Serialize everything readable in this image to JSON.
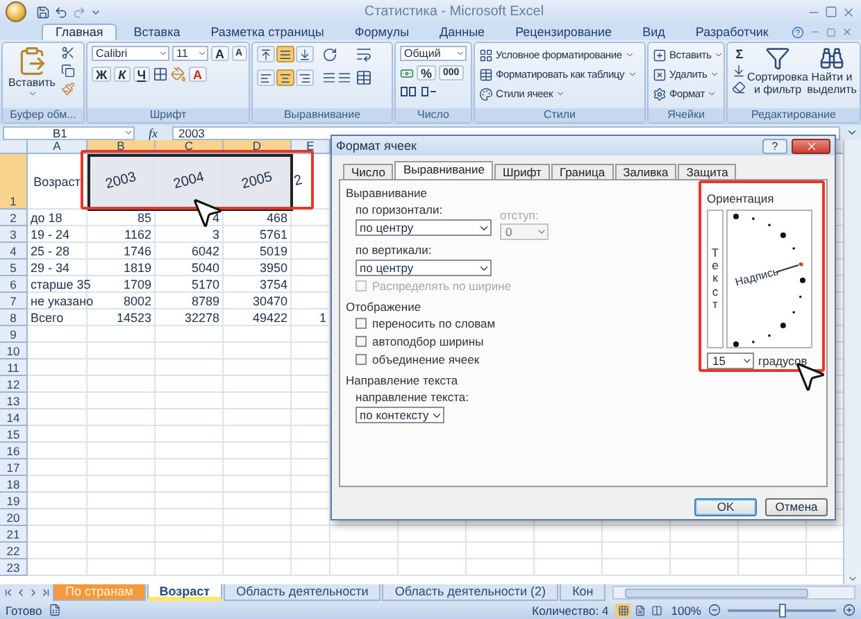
{
  "window": {
    "title": "Статистика - Microsoft Excel"
  },
  "ribbon_tabs": [
    {
      "label": "Главная",
      "selected": true
    },
    {
      "label": "Вставка",
      "selected": false
    },
    {
      "label": "Разметка страницы",
      "selected": false
    },
    {
      "label": "Формулы",
      "selected": false
    },
    {
      "label": "Данные",
      "selected": false
    },
    {
      "label": "Рецензирование",
      "selected": false
    },
    {
      "label": "Вид",
      "selected": false
    },
    {
      "label": "Разработчик",
      "selected": false
    }
  ],
  "ribbon": {
    "clipboard": {
      "label": "Буфер обм...",
      "paste": "Вставить"
    },
    "font": {
      "label": "Шрифт",
      "font_name": "Calibri",
      "font_size": "11",
      "grow": "A",
      "shrink": "A",
      "styles": [
        "Ж",
        "К",
        "Ч"
      ],
      "font_color": "A"
    },
    "alignment": {
      "label": "Выравнивание",
      "vertical": [
        {
          "selected": false
        },
        {
          "selected": true
        },
        {
          "selected": false
        }
      ],
      "horizontal": [
        {
          "selected": false
        },
        {
          "selected": true
        },
        {
          "selected": false
        }
      ]
    },
    "number": {
      "label": "Число",
      "format": "Общий",
      "percent": "%",
      "thousands": "000"
    },
    "styles": {
      "label": "Стили",
      "commands": [
        "Условное форматирование",
        "Форматировать как таблицу",
        "Стили ячеек"
      ]
    },
    "cells": {
      "label": "Ячейки",
      "commands": [
        "Вставить",
        "Удалить",
        "Формат"
      ]
    },
    "editing": {
      "label": "Редактирование",
      "sum": "Σ",
      "sort": "Сортировка и фильтр",
      "find": "Найти и выделить"
    }
  },
  "formula_bar": {
    "name_box": "B1",
    "function_label": "fx",
    "value": "2003"
  },
  "sheet": {
    "columns": [
      {
        "label": "A",
        "selected": false
      },
      {
        "label": "B",
        "selected": true
      },
      {
        "label": "C",
        "selected": true
      },
      {
        "label": "D",
        "selected": true
      },
      {
        "label": "E",
        "selected": false
      }
    ],
    "rows": [
      {
        "number": "1",
        "selected": true,
        "cells": [
          "Возраст",
          "2003",
          "2004",
          "2005",
          "2"
        ]
      },
      {
        "number": "2",
        "selected": false,
        "cells": [
          "до 18",
          "85",
          "4",
          "468",
          ""
        ]
      },
      {
        "number": "3",
        "selected": false,
        "cells": [
          "19 - 24",
          "1162",
          "3",
          "5761",
          ""
        ]
      },
      {
        "number": "4",
        "selected": false,
        "cells": [
          "25 - 28",
          "1746",
          "6042",
          "5019",
          ""
        ]
      },
      {
        "number": "5",
        "selected": false,
        "cells": [
          "29 - 34",
          "1819",
          "5040",
          "3950",
          ""
        ]
      },
      {
        "number": "6",
        "selected": false,
        "cells": [
          "старше 35",
          "1709",
          "5170",
          "3754",
          ""
        ]
      },
      {
        "number": "7",
        "selected": false,
        "cells": [
          "не указано",
          "8002",
          "8789",
          "30470",
          ""
        ]
      },
      {
        "number": "8",
        "selected": false,
        "cells": [
          "Всего",
          "14523",
          "32278",
          "49422",
          "1"
        ]
      }
    ],
    "empty_rows": [
      "9",
      "10",
      "11",
      "12",
      "13",
      "14",
      "15",
      "16",
      "17",
      "18",
      "19",
      "20",
      "21",
      "22",
      "23"
    ]
  },
  "dialog": {
    "title": "Формат ячеек",
    "help": "?",
    "tabs": [
      {
        "label": "Число",
        "selected": false
      },
      {
        "label": "Выравнивание",
        "selected": true
      },
      {
        "label": "Шрифт",
        "selected": false
      },
      {
        "label": "Граница",
        "selected": false
      },
      {
        "label": "Заливка",
        "selected": false
      },
      {
        "label": "Защита",
        "selected": false
      }
    ],
    "alignment": {
      "heading": "Выравнивание",
      "horizontal_label": "по горизонтали:",
      "horizontal_value": "по центру",
      "indent_label": "отступ:",
      "indent_value": "0",
      "indent_disabled": true,
      "vertical_label": "по вертикали:",
      "vertical_value": "по центру",
      "distribute": {
        "label": "Распределять по ширине",
        "checked": false,
        "disabled": true
      }
    },
    "display": {
      "heading": "Отображение",
      "options": [
        {
          "label": "переносить по словам",
          "checked": false
        },
        {
          "label": "автоподбор ширины",
          "checked": false
        },
        {
          "label": "объединение ячеек",
          "checked": false
        }
      ]
    },
    "direction": {
      "heading": "Направление текста",
      "label": "направление текста:",
      "value": "по контексту"
    },
    "orientation": {
      "heading": "Ориентация",
      "vertical_text": "Текст",
      "sample": "Надпись",
      "degrees": "15",
      "unit": "градусов"
    },
    "buttons": [
      {
        "label": "OK",
        "default": true
      },
      {
        "label": "Отмена",
        "default": false
      }
    ]
  },
  "sheet_tabs": [
    {
      "label": "По странам",
      "selected": false,
      "color": "#f59a3c"
    },
    {
      "label": "Возраст",
      "selected": true,
      "color": "#ffe866"
    },
    {
      "label": "Область деятельности",
      "selected": false
    },
    {
      "label": "Область деятельности (2)",
      "selected": false
    },
    {
      "label": "Кон",
      "selected": false
    }
  ],
  "status_bar": {
    "ready": "Готово",
    "count": "Количество: 4",
    "views": [
      {
        "selected": true
      },
      {
        "selected": false
      },
      {
        "selected": false
      }
    ],
    "zoom": "100%",
    "zoom_slider": {
      "level": 0.5
    }
  }
}
